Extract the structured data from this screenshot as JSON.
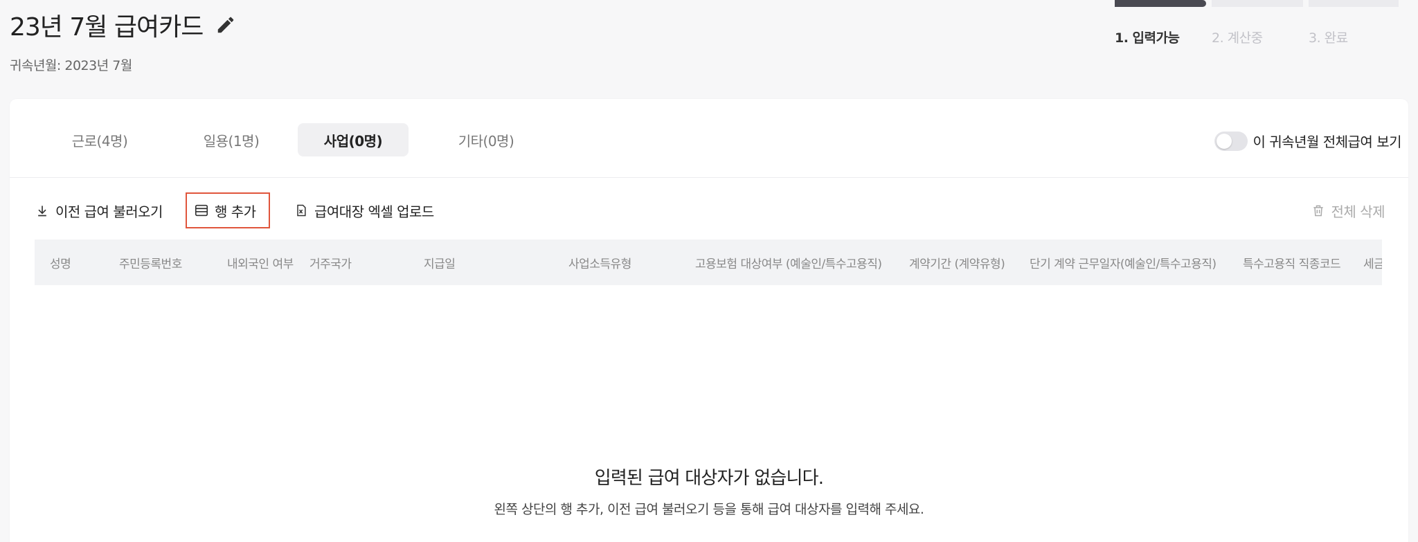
{
  "header": {
    "title": "23년 7월 급여카드",
    "subtitle": "귀속년월: 2023년 7월"
  },
  "stepper": {
    "steps": [
      {
        "label": "1. 입력가능",
        "active": true
      },
      {
        "label": "2. 계산중",
        "active": false
      },
      {
        "label": "3. 완료",
        "active": false
      }
    ]
  },
  "tabs": [
    {
      "label": "근로(4명)",
      "active": false
    },
    {
      "label": "일용(1명)",
      "active": false
    },
    {
      "label": "사업(0명)",
      "active": true
    },
    {
      "label": "기타(0명)",
      "active": false
    }
  ],
  "toggle": {
    "label": "이 귀속년월 전체급여 보기",
    "on": false
  },
  "toolbar": {
    "load_previous": "이전 급여 불러오기",
    "add_row": "행 추가",
    "excel_upload": "급여대장 엑셀 업로드",
    "delete_all": "전체 삭제"
  },
  "table": {
    "columns": [
      "성명",
      "주민등록번호",
      "내외국인 여부",
      "거주국가",
      "지급일",
      "사업소득유형",
      "고용보험 대상여부 (예술인/특수고용직)",
      "계약기간 (계약유형)",
      "단기 계약 근무일자(예술인/특수고용직)",
      "특수고용직 직종코드",
      "세금"
    ]
  },
  "empty_state": {
    "title": "입력된 급여 대상자가 없습니다.",
    "description": "왼쪽 상단의 행 추가, 이전 급여 불러오기 등을 통해 급여 대상자를 입력해 주세요."
  },
  "colors": {
    "accent_dark": "#4a4a52",
    "highlight_border": "#e0553b",
    "header_bg": "#f2f3f5"
  }
}
